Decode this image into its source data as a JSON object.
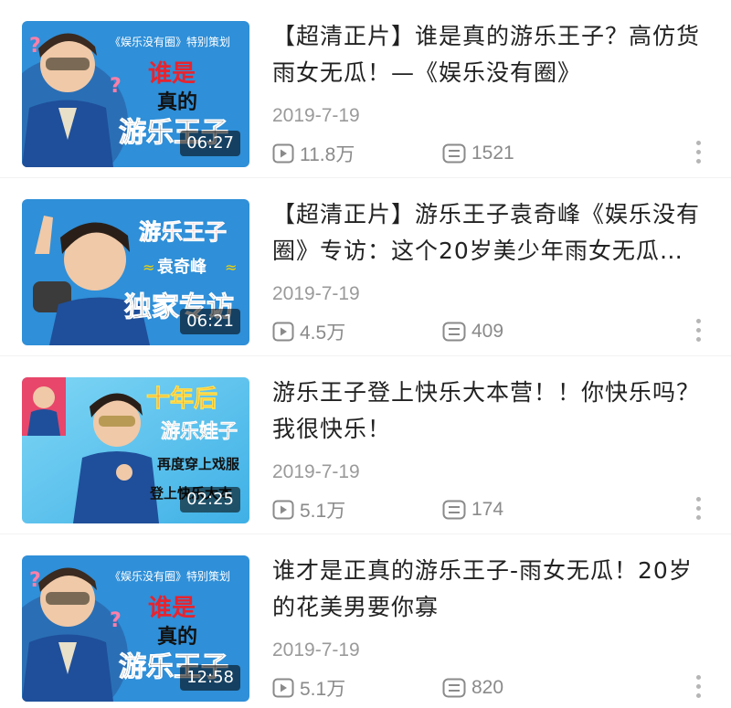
{
  "videos": [
    {
      "title": "【超清正片】谁是真的游乐王子？高仿货雨女无瓜！—《娱乐没有圈》",
      "date": "2019-7-19",
      "duration": "06:27",
      "views": "11.8万",
      "comments": "1521",
      "thumb_texts": [
        "《娱乐没有圈》特别策划",
        "谁是",
        "真的",
        "游乐王子"
      ]
    },
    {
      "title": "【超清正片】游乐王子袁奇峰《娱乐没有圈》专访：这个20岁美少年雨女无瓜…",
      "date": "2019-7-19",
      "duration": "06:21",
      "views": "4.5万",
      "comments": "409",
      "thumb_texts": [
        "游乐王子",
        "袁奇峰",
        "独家专访"
      ]
    },
    {
      "title": "游乐王子登上快乐大本营！！你快乐吗？我很快乐！",
      "date": "2019-7-19",
      "duration": "02:25",
      "views": "5.1万",
      "comments": "174",
      "thumb_texts": [
        "十年后",
        "游乐娃子",
        "再度穿上戏服",
        "登上快乐大本"
      ]
    },
    {
      "title": "谁才是正真的游乐王子-雨女无瓜！20岁的花美男要你寡",
      "date": "2019-7-19",
      "duration": "12:58",
      "views": "5.1万",
      "comments": "820",
      "thumb_texts": [
        "《娱乐没有圈》特别策划",
        "谁是",
        "真的",
        "游乐王子"
      ]
    }
  ],
  "icons": {
    "views": "play-count-icon",
    "comments": "comment-count-icon",
    "more": "more-menu-icon"
  },
  "colors": {
    "title": "#222222",
    "meta": "#9a9a9a",
    "thumb_blue": "#2f8fd8",
    "thumb_red": "#e8232e"
  }
}
